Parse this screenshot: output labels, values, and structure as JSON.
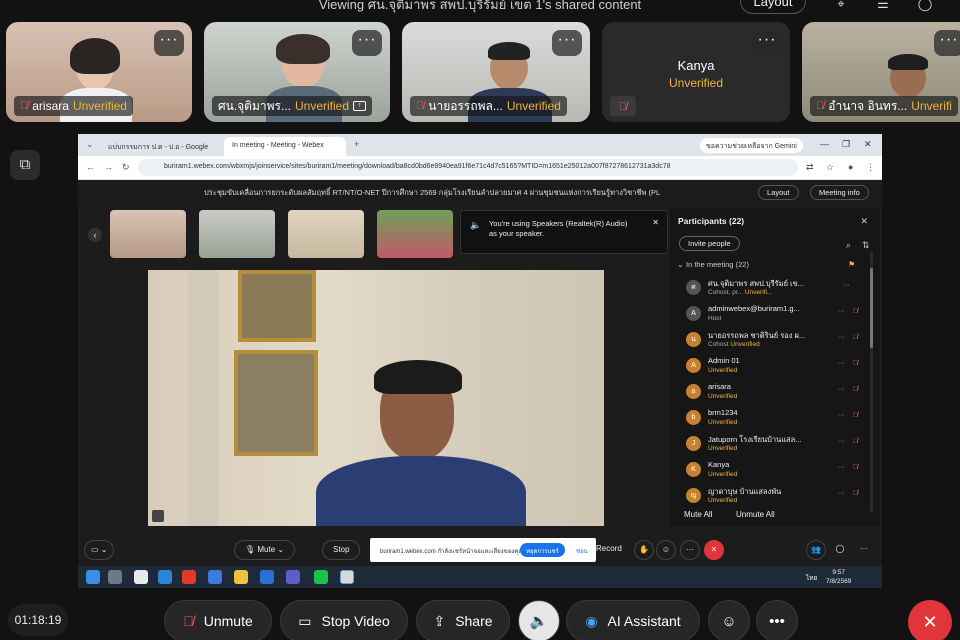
{
  "header": {
    "viewing_text": "Viewing ศน.จุติมาพร สพป.บุรีรัมย์ เขต 1's shared content",
    "layout_label": "Layout"
  },
  "tiles": [
    {
      "name": "arisara",
      "status": "Unverified"
    },
    {
      "name": "ศน.จุติมาพร...",
      "status": "Unverified"
    },
    {
      "name": "นายอรรถพล...",
      "status": "Unverified"
    },
    {
      "name": "Kanya",
      "status": "Unverified"
    },
    {
      "name": "อำนาจ อินทร...",
      "status": "Unverifi"
    }
  ],
  "browser": {
    "tab1": "แบ่บกรรมการ ป.ต - ป.อ - Google",
    "tab2": "In meeting - Meeting - Webex",
    "gemini": "ขอความช่วยเหลือจาก Gemini",
    "url": "buriram1.webex.com/wbxmjs/joinservice/sites/buriram1/meeting/download/ba8cd0bd6e8940ea91f6e71c4d7c5165?MTID=m1651e25012a007f87278612731a3dc78"
  },
  "webex": {
    "meeting_title": "ประชุมขับเคลื่อนการยกระดับผลสัมฤทธิ์ RT/NT/O-NET ปีการศึกษา 2569 กลุ่มโรงเรียนลำปลายมาศ 4 ผ่านชุมชนแห่งการเรียนรู้ทางวิชาชีพ (PL",
    "layout_btn": "Layout",
    "meeting_info_btn": "Meeting info",
    "speaker_msg_a": "You're using Speakers (Realtek(R) Audio)",
    "speaker_msg_b": "as your speaker.",
    "panel_title": "Participants (22)",
    "invite_label": "Invite people",
    "in_meeting_label": "In the meeting (22)",
    "mute_all": "Mute All",
    "unmute_all": "Unmute All",
    "participants": [
      {
        "initial": "ศ",
        "name": "ศน.จุติมาพร สพป.บุรีรัมย์ เข...",
        "role": "Cohost, pr...",
        "status": "Unverifi..."
      },
      {
        "initial": "A",
        "name": "adminwebex@buriram1.g...",
        "role": "Host",
        "status": ""
      },
      {
        "initial": "น",
        "name": "นายอรรถพล ชาติรินย์ รอง ผ...",
        "role": "Cohost",
        "status": "Unverified"
      },
      {
        "initial": "A",
        "name": "Admin 01",
        "role": "",
        "status": "Unverified"
      },
      {
        "initial": "a",
        "name": "arisara",
        "role": "",
        "status": "Unverified"
      },
      {
        "initial": "b",
        "name": "brm1234",
        "role": "",
        "status": "Unverified"
      },
      {
        "initial": "J",
        "name": "Jatuporn โรงเรียนบ้านแสล...",
        "role": "",
        "status": "Unverified"
      },
      {
        "initial": "K",
        "name": "Kanya",
        "role": "",
        "status": "Unverified"
      },
      {
        "initial": "ญ",
        "name": "ญาดาบุษ บ้านแสลงพัน",
        "role": "",
        "status": "Unverified"
      }
    ],
    "inner_mute": "Mute",
    "inner_stop": "Stop",
    "inner_record": "Record",
    "notif_text": "buriram1.webex.com กำลังแชร์หน้าจอและเสียงของคุณ",
    "notif_btn": "หยุดการแชร์",
    "notif_hide": "ซ่อน"
  },
  "taskbar": {
    "lang": "ไทย",
    "time": "9:57",
    "date": "7/8/2569"
  },
  "controls": {
    "timer": "01:18:19",
    "unmute": "Unmute",
    "stop_video": "Stop Video",
    "share": "Share",
    "ai_assistant": "AI Assistant"
  }
}
